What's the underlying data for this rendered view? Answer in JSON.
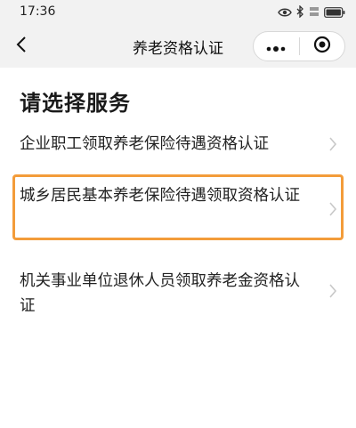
{
  "status_bar": {
    "time": "17:36",
    "icons": [
      "eye-icon",
      "bluetooth-icon",
      "network-speed-icon",
      "battery-icon"
    ]
  },
  "nav": {
    "title": "养老资格认证",
    "back_icon": "chevron-left-icon",
    "more_icon": "more-dots-icon",
    "close_icon": "target-close-icon"
  },
  "section": {
    "title": "请选择服务"
  },
  "services": [
    {
      "label": "企业职工领取养老保险待遇资格认证"
    },
    {
      "label": "城乡居民基本养老保险待遇领取资格认证"
    },
    {
      "label": "机关事业单位退休人员领取养老金资格认证"
    }
  ],
  "colors": {
    "header_bg": "#f2f2f2",
    "highlight_border": "#f39c3a",
    "chevron": "#c8c8c8"
  }
}
